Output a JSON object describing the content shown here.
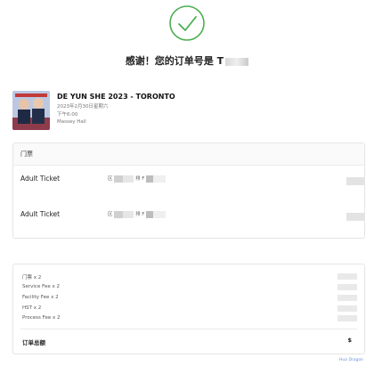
{
  "status": {
    "title_prefix": "感谢！您的订单号是 ",
    "order_no_visible": "T",
    "icon": "check-circle-icon",
    "accent": "#4caf50"
  },
  "event": {
    "title": "DE YUN SHE 2023 - TORONTO",
    "date": "2023年2月30日星期六",
    "time": "下午6:00",
    "venue": "Massey Hall"
  },
  "tickets": {
    "header": "门票",
    "rows": [
      {
        "type": "Adult Ticket",
        "seat_prefix": "区",
        "row_label": "排 F"
      },
      {
        "type": "Adult Ticket",
        "seat_prefix": "区",
        "row_label": "排 F"
      }
    ]
  },
  "summary": {
    "lines": [
      "门票 x 2",
      "Service Fee x 2",
      "Facility Fee x 2",
      "HST x 2",
      "Process Fee x 2"
    ],
    "total_label": "订单总额",
    "total_value": "$"
  },
  "footer": {
    "link": "Hua Dragon"
  }
}
